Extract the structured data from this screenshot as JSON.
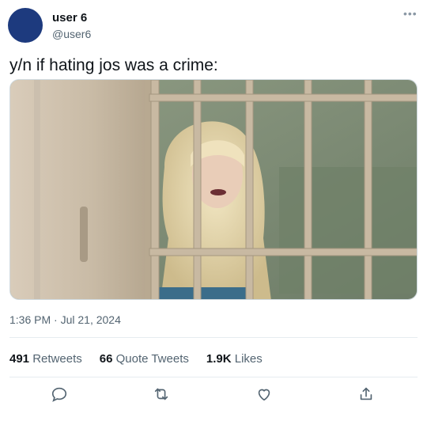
{
  "author": {
    "display_name": "user 6",
    "handle": "@user6"
  },
  "tweet": {
    "text": "y/n if hating jos was a crime:",
    "timestamp": "1:36 PM · Jul 21, 2024"
  },
  "stats": {
    "retweets_count": "491",
    "retweets_label": "Retweets",
    "quotes_count": "66",
    "quotes_label": "Quote Tweets",
    "likes_count": "1.9K",
    "likes_label": "Likes"
  },
  "icons": {
    "more": "more-icon",
    "reply": "reply-icon",
    "retweet": "retweet-icon",
    "like": "like-icon",
    "share": "share-icon"
  },
  "colors": {
    "avatar": "#1d3a7e",
    "text": "#0f1419",
    "secondary": "#536471"
  }
}
